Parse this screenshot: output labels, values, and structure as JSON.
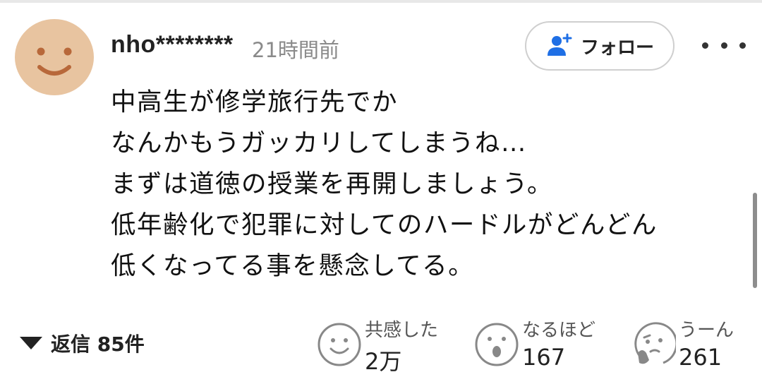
{
  "comment": {
    "username": "nho********",
    "timestamp": "21時間前",
    "lines": [
      "中高生が修学旅行先でか",
      "なんかもうガッカリしてしまうね…",
      "まずは道徳の授業を再開しましょう。",
      "低年齢化で犯罪に対してのハードルがどんどん",
      "低くなってる事を懸念してる。"
    ]
  },
  "header": {
    "follow_label": "フォロー",
    "more_icon": "more-horizontal-icon"
  },
  "replies": {
    "label": "返信 85件"
  },
  "reactions": [
    {
      "label": "共感した",
      "count": "2万",
      "icon": "smile-face-icon"
    },
    {
      "label": "なるほど",
      "count": "167",
      "icon": "surprised-face-icon"
    },
    {
      "label": "うーん",
      "count": "261",
      "icon": "thinking-face-icon"
    }
  ],
  "colors": {
    "avatar": "#e8c4a0",
    "follow_icon": "#1f6fe5",
    "muted_text": "#8a8a8a"
  }
}
